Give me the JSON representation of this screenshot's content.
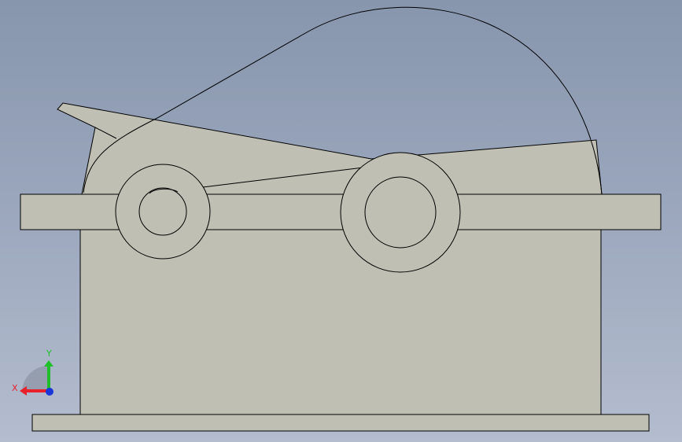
{
  "viewport": {
    "background_top": "#8796ad",
    "background_bottom": "#b4bdce",
    "part_fill": "#c0bfb4",
    "edge_color": "#000000"
  },
  "model": {
    "description_icon": "gear-reducer-housing"
  },
  "triad": {
    "x_label": "X",
    "y_label": "Y",
    "x_color": "#e8202a",
    "y_color": "#1fbf2a",
    "z_color": "#1a36d6"
  }
}
